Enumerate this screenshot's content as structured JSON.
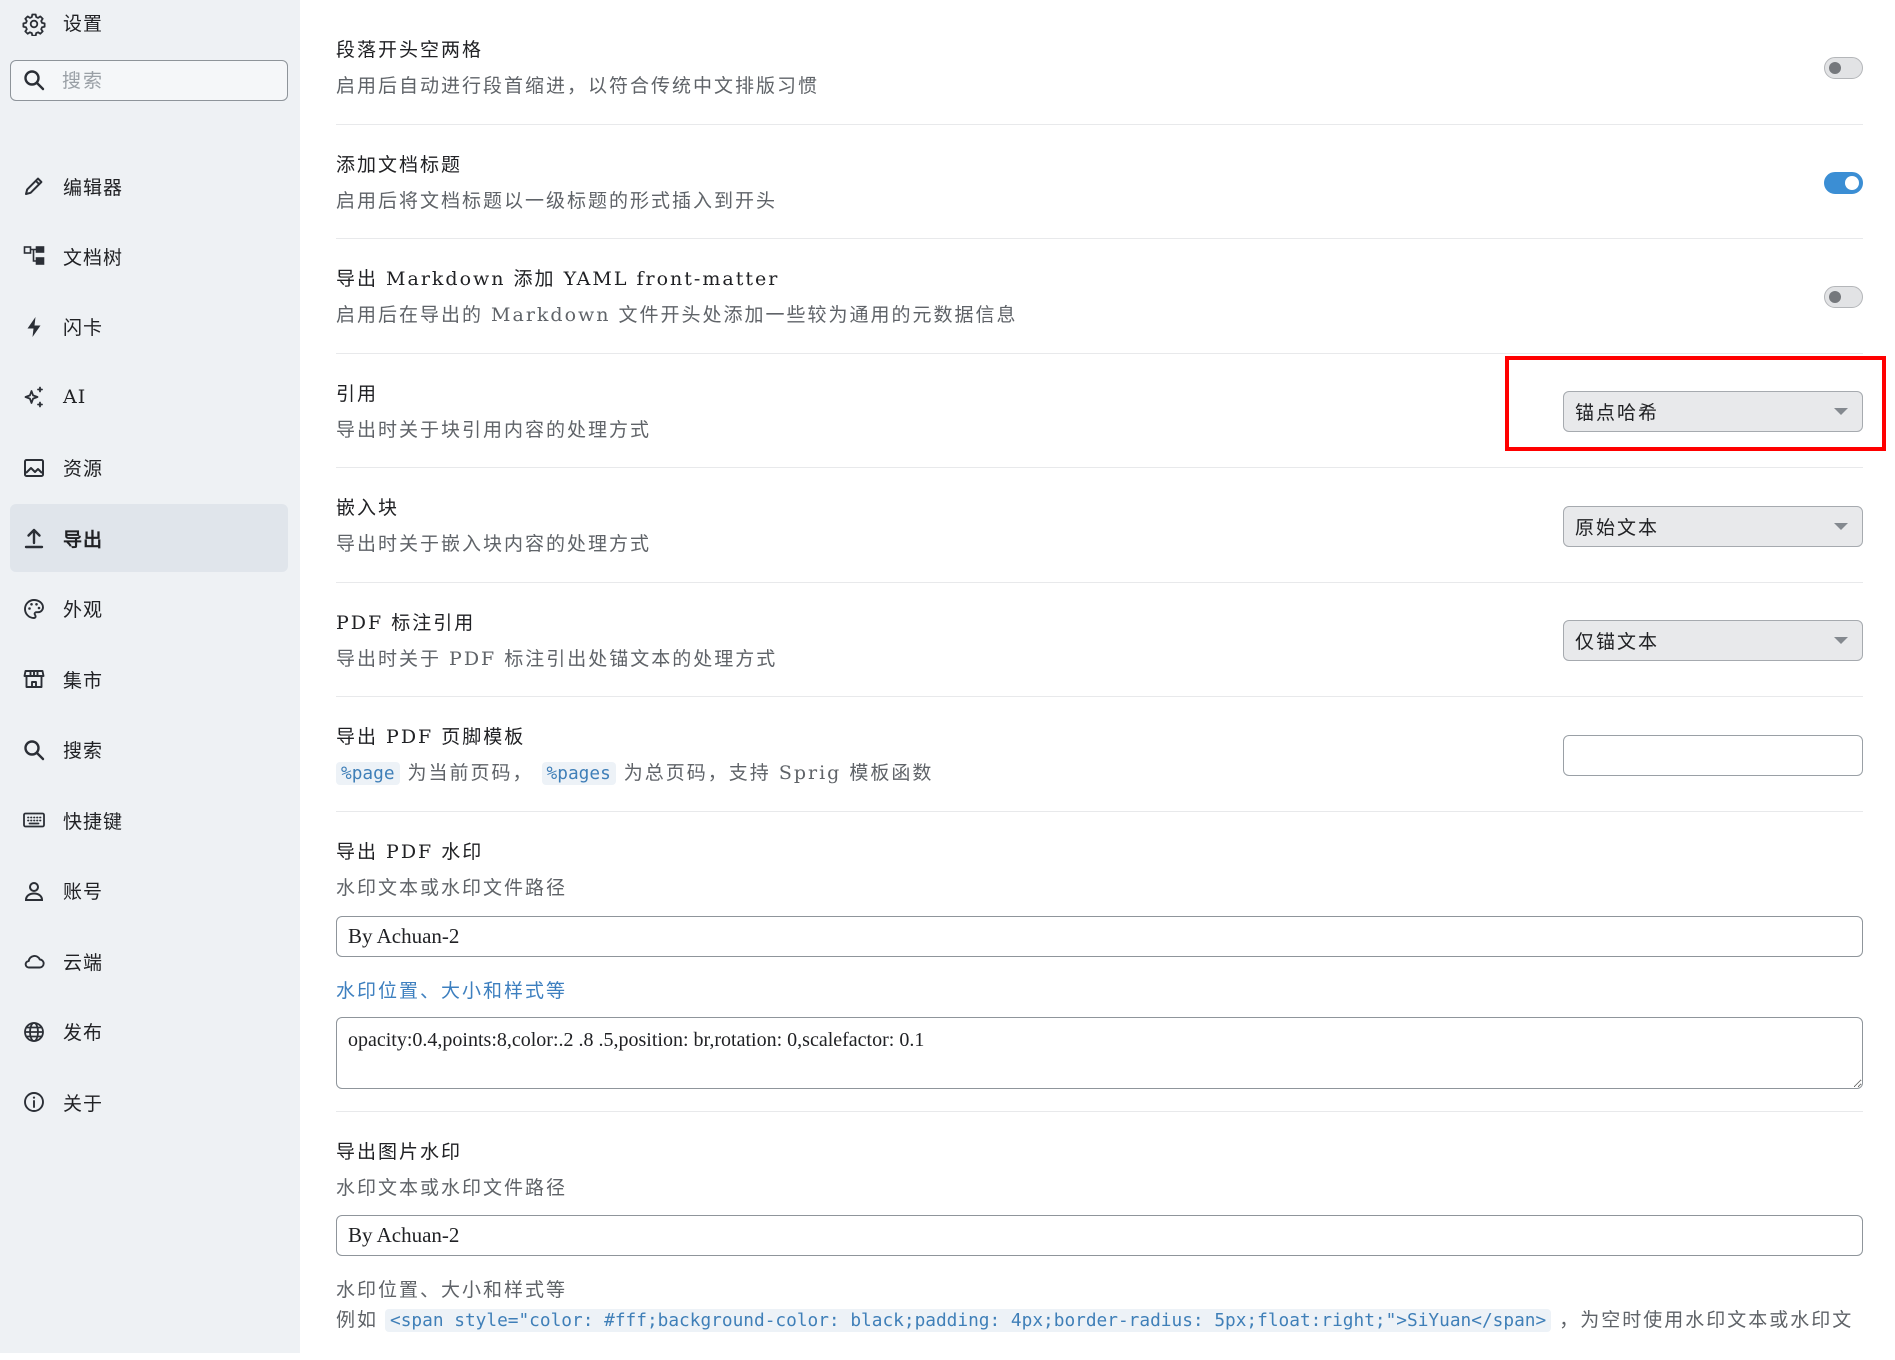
{
  "colors": {
    "accent": "#3b8ed4",
    "link": "#3d7fbf",
    "highlight": "#ff0000",
    "sidebar_bg": "#eef1f4",
    "sidebar_active_bg": "#e0e5eb"
  },
  "sidebar": {
    "title": "设置",
    "title_icon": "gear-icon",
    "search": {
      "placeholder": "搜索",
      "value": "",
      "icon": "search-icon"
    },
    "items": [
      {
        "label": "编辑器",
        "icon": "pencil-icon"
      },
      {
        "label": "文档树",
        "icon": "tree-icon"
      },
      {
        "label": "闪卡",
        "icon": "lightning-icon"
      },
      {
        "label": "AI",
        "icon": "sparkles-icon"
      },
      {
        "label": "资源",
        "icon": "image-icon"
      },
      {
        "label": "导出",
        "icon": "upload-icon",
        "active": true
      },
      {
        "label": "外观",
        "icon": "palette-icon"
      },
      {
        "label": "集市",
        "icon": "store-icon"
      },
      {
        "label": "搜索",
        "icon": "search-icon"
      },
      {
        "label": "快捷键",
        "icon": "keyboard-icon"
      },
      {
        "label": "账号",
        "icon": "user-icon"
      },
      {
        "label": "云端",
        "icon": "cloud-icon"
      },
      {
        "label": "发布",
        "icon": "globe-icon"
      },
      {
        "label": "关于",
        "icon": "info-icon"
      }
    ]
  },
  "settings": [
    {
      "title": "段落开头空两格",
      "description": "启用后自动进行段首缩进，以符合传统中文排版习惯",
      "checked": false
    },
    {
      "title": "添加文档标题",
      "description": "启用后将文档标题以一级标题的形式插入到开头",
      "checked": true
    },
    {
      "title": "导出 Markdown 添加 YAML front-matter",
      "description": "启用后在导出的 Markdown 文件开头处添加一些较为通用的元数据信息",
      "checked": false
    },
    {
      "title": "引用",
      "description": "导出时关于块引用内容的处理方式",
      "selected": "锚点哈希",
      "highlighted": true
    },
    {
      "title": "嵌入块",
      "description": "导出时关于嵌入块内容的处理方式",
      "selected": "原始文本"
    },
    {
      "title": "PDF 标注引用",
      "description": "导出时关于 PDF 标注引出处锚文本的处理方式",
      "selected": "仅锚文本"
    },
    {
      "title": "导出 PDF 页脚模板",
      "description": {
        "code1": "%page",
        "text1": "为当前页码，",
        "code2": "%pages",
        "text2": "为总页码，支持 Sprig 模板函数"
      },
      "value": ""
    },
    {
      "title": "导出 PDF 水印",
      "description": "水印文本或水印文件路径",
      "value": "By Achuan-2",
      "options_label": "水印位置、大小和样式等",
      "options_value": "opacity:0.4,points:8,color:.2 .8 .5,position: br,rotation: 0,scalefactor: 0.1"
    },
    {
      "title": "导出图片水印",
      "description": "水印文本或水印文件路径",
      "value": "By Achuan-2",
      "options_label": "水印位置、大小和样式等",
      "options_example": {
        "prefix": "例如",
        "code": "<span style=\"color: #fff;background-color: black;padding: 4px;border-radius: 5px;float:right;\">SiYuan</span>",
        "suffix": "，为空时使用水印文本或水印文"
      }
    }
  ]
}
